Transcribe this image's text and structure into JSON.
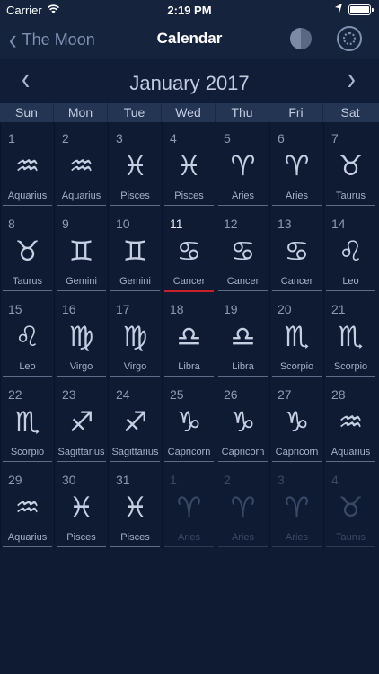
{
  "status": {
    "carrier": "Carrier",
    "time": "2:19 PM"
  },
  "nav": {
    "back_label": "The Moon",
    "title": "Calendar"
  },
  "month": {
    "title": "January 2017"
  },
  "weekdays": [
    "Sun",
    "Mon",
    "Tue",
    "Wed",
    "Thu",
    "Fri",
    "Sat"
  ],
  "days": [
    {
      "num": "1",
      "sign": "Aquarius",
      "glyph": "♒",
      "other": false,
      "today": false
    },
    {
      "num": "2",
      "sign": "Aquarius",
      "glyph": "♒",
      "other": false,
      "today": false
    },
    {
      "num": "3",
      "sign": "Pisces",
      "glyph": "♓",
      "other": false,
      "today": false
    },
    {
      "num": "4",
      "sign": "Pisces",
      "glyph": "♓",
      "other": false,
      "today": false
    },
    {
      "num": "5",
      "sign": "Aries",
      "glyph": "♈",
      "other": false,
      "today": false
    },
    {
      "num": "6",
      "sign": "Aries",
      "glyph": "♈",
      "other": false,
      "today": false
    },
    {
      "num": "7",
      "sign": "Taurus",
      "glyph": "♉",
      "other": false,
      "today": false
    },
    {
      "num": "8",
      "sign": "Taurus",
      "glyph": "♉",
      "other": false,
      "today": false
    },
    {
      "num": "9",
      "sign": "Gemini",
      "glyph": "♊",
      "other": false,
      "today": false
    },
    {
      "num": "10",
      "sign": "Gemini",
      "glyph": "♊",
      "other": false,
      "today": false
    },
    {
      "num": "11",
      "sign": "Cancer",
      "glyph": "♋",
      "other": false,
      "today": true
    },
    {
      "num": "12",
      "sign": "Cancer",
      "glyph": "♋",
      "other": false,
      "today": false
    },
    {
      "num": "13",
      "sign": "Cancer",
      "glyph": "♋",
      "other": false,
      "today": false
    },
    {
      "num": "14",
      "sign": "Leo",
      "glyph": "♌",
      "other": false,
      "today": false
    },
    {
      "num": "15",
      "sign": "Leo",
      "glyph": "♌",
      "other": false,
      "today": false
    },
    {
      "num": "16",
      "sign": "Virgo",
      "glyph": "♍",
      "other": false,
      "today": false
    },
    {
      "num": "17",
      "sign": "Virgo",
      "glyph": "♍",
      "other": false,
      "today": false
    },
    {
      "num": "18",
      "sign": "Libra",
      "glyph": "♎",
      "other": false,
      "today": false
    },
    {
      "num": "19",
      "sign": "Libra",
      "glyph": "♎",
      "other": false,
      "today": false
    },
    {
      "num": "20",
      "sign": "Scorpio",
      "glyph": "♏",
      "other": false,
      "today": false
    },
    {
      "num": "21",
      "sign": "Scorpio",
      "glyph": "♏",
      "other": false,
      "today": false
    },
    {
      "num": "22",
      "sign": "Scorpio",
      "glyph": "♏",
      "other": false,
      "today": false
    },
    {
      "num": "23",
      "sign": "Sagittarius",
      "glyph": "♐",
      "other": false,
      "today": false
    },
    {
      "num": "24",
      "sign": "Sagittarius",
      "glyph": "♐",
      "other": false,
      "today": false
    },
    {
      "num": "25",
      "sign": "Capricorn",
      "glyph": "♑",
      "other": false,
      "today": false
    },
    {
      "num": "26",
      "sign": "Capricorn",
      "glyph": "♑",
      "other": false,
      "today": false
    },
    {
      "num": "27",
      "sign": "Capricorn",
      "glyph": "♑",
      "other": false,
      "today": false
    },
    {
      "num": "28",
      "sign": "Aquarius",
      "glyph": "♒",
      "other": false,
      "today": false
    },
    {
      "num": "29",
      "sign": "Aquarius",
      "glyph": "♒",
      "other": false,
      "today": false
    },
    {
      "num": "30",
      "sign": "Pisces",
      "glyph": "♓",
      "other": false,
      "today": false
    },
    {
      "num": "31",
      "sign": "Pisces",
      "glyph": "♓",
      "other": false,
      "today": false
    },
    {
      "num": "1",
      "sign": "Aries",
      "glyph": "♈",
      "other": true,
      "today": false
    },
    {
      "num": "2",
      "sign": "Aries",
      "glyph": "♈",
      "other": true,
      "today": false
    },
    {
      "num": "3",
      "sign": "Aries",
      "glyph": "♈",
      "other": true,
      "today": false
    },
    {
      "num": "4",
      "sign": "Taurus",
      "glyph": "♉",
      "other": true,
      "today": false
    }
  ],
  "colors": {
    "background": "#0f1b33",
    "bar": "#16233d",
    "weekday_bar": "#243453",
    "today_marker": "#c8202a"
  },
  "icons": {
    "wifi": "wifi-icon",
    "location": "location-arrow-icon",
    "battery": "battery-icon",
    "back": "chevron-left-icon",
    "moon": "moon-phase-icon",
    "zodiac": "zodiac-wheel-icon"
  }
}
